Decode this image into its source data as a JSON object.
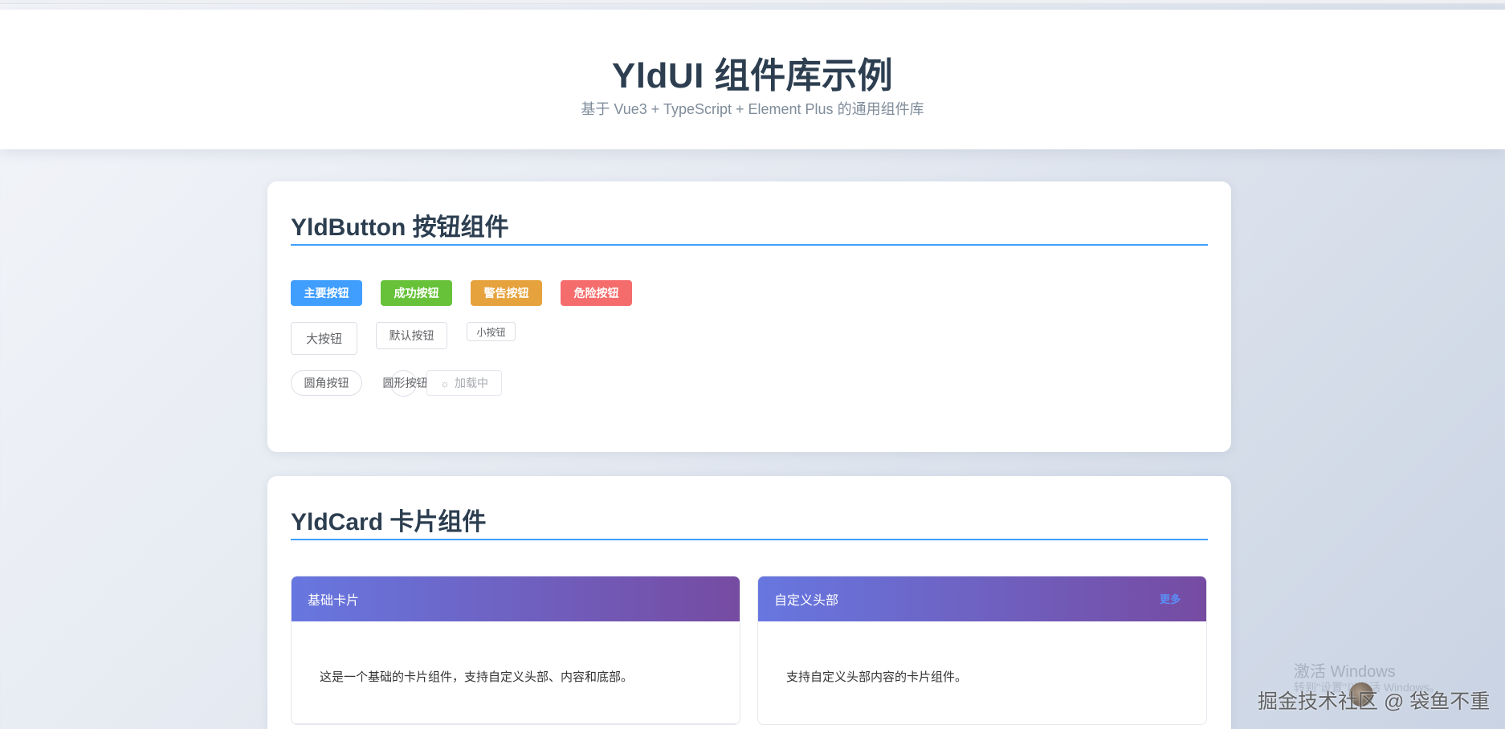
{
  "header": {
    "title": "YldUI 组件库示例",
    "subtitle": "基于 Vue3 + TypeScript + Element Plus 的通用组件库"
  },
  "button_section": {
    "title": "YldButton 按钮组件",
    "type_buttons": {
      "primary": "主要按钮",
      "success": "成功按钮",
      "warning": "警告按钮",
      "danger": "危险按钮"
    },
    "size_buttons": {
      "large": "大按钮",
      "default": "默认按钮",
      "small": "小按钮"
    },
    "shape_buttons": {
      "round": "圆角按钮",
      "circle": "圆形按钮",
      "loading": "加载中"
    }
  },
  "card_section": {
    "title": "YldCard 卡片组件",
    "basic_card": {
      "header": "基础卡片",
      "body": "这是一个基础的卡片组件，支持自定义头部、内容和底部。"
    },
    "custom_card": {
      "header": "自定义头部",
      "more_link": "更多",
      "body": "支持自定义头部内容的卡片组件。"
    }
  },
  "overlay": {
    "activate_windows": "激活 Windows",
    "activate_windows_sub": "转到\"设置\"以激活 Windows。",
    "site_watermark": "掘金技术社区 @ 袋鱼不重"
  },
  "colors": {
    "primary": "#409eff",
    "success": "#67c23a",
    "warning": "#e6a23c",
    "danger": "#f56c6c",
    "card_header_gradient_start": "#6777e0",
    "card_header_gradient_end": "#764ba2"
  },
  "icons": {
    "loading": "spinner-icon"
  }
}
